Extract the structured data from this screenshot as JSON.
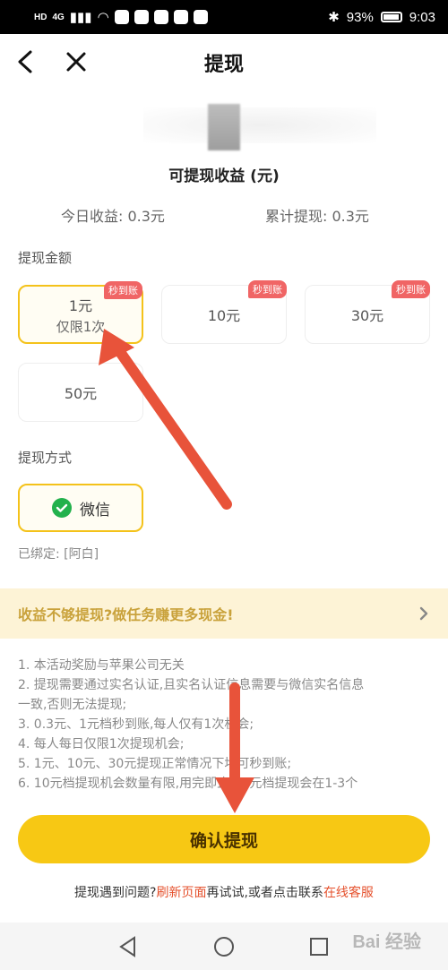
{
  "status_bar": {
    "left_tags": [
      "HD",
      "4G"
    ],
    "battery": "93%",
    "time": "9:03"
  },
  "nav": {
    "title": "提现",
    "back_icon": "chevron-left-icon",
    "close_icon": "close-icon"
  },
  "header": {
    "balance_label": "可提现收益 (元)",
    "today_income": "今日收益: 0.3元",
    "total_withdrawn": "累计提现: 0.3元"
  },
  "amount_section": {
    "title": "提现金额",
    "options": [
      {
        "amount": "1元",
        "note": "仅限1次",
        "badge": "秒到账",
        "selected": true
      },
      {
        "amount": "10元",
        "note": "",
        "badge": "秒到账",
        "selected": false
      },
      {
        "amount": "30元",
        "note": "",
        "badge": "秒到账",
        "selected": false
      },
      {
        "amount": "50元",
        "note": "",
        "badge": "",
        "selected": false
      }
    ]
  },
  "method_section": {
    "title": "提现方式",
    "method": "微信",
    "method_icon": "wechat-icon",
    "bound": "已绑定: [阿白]"
  },
  "promo": {
    "text": "收益不够提现?做任务赚更多现金!",
    "icon": "chevron-right-icon"
  },
  "rules": [
    "1. 本活动奖励与苹果公司无关",
    "2. 提现需要通过实名认证,且实名认证信息需要与微信实名信息",
    "一致,否则无法提现;",
    "3. 0.3元、1元档秒到账,每人仅有1次机会;",
    "4. 每人每日仅限1次提现机会;",
    "5. 1元、10元、30元提现正常情况下均可秒到账;",
    "6. 10元档提现机会数量有限,用完即止,50元档提现会在1-3个"
  ],
  "confirm_button": "确认提现",
  "help": {
    "prefix": "提现遇到问题?",
    "refresh_link": "刷新页面",
    "middle": "再试试,或者点击联系",
    "service_link": "在线客服"
  },
  "watermark": "Bai 经验",
  "colors": {
    "accent": "#f7c814",
    "badge": "#f06565",
    "link": "#e5512d",
    "annotation_arrow": "#e8533a",
    "wechat": "#22b14c"
  }
}
